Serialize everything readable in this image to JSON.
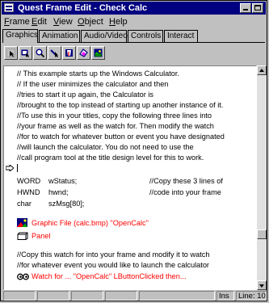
{
  "window": {
    "title": "Quest Frame Edit - Check Calc"
  },
  "menu": [
    {
      "label": "Frame",
      "u": "F",
      "rest": "rame"
    },
    {
      "label": "Edit",
      "u": "E",
      "rest": "dit"
    },
    {
      "label": "View",
      "u": "V",
      "rest": "iew"
    },
    {
      "label": "Object",
      "u": "O",
      "rest": "bject"
    },
    {
      "label": "Help",
      "u": "H",
      "rest": "elp"
    }
  ],
  "tabs": [
    "Graphics",
    "Animation",
    "Audio/Video",
    "Controls",
    "Interact"
  ],
  "active_tab": "Graphics",
  "toolbar_icons": [
    "pointer-tool-icon",
    "frame-tool-icon",
    "zoom-tool-icon",
    "line-tool-icon",
    "bucket-tool-icon",
    "paint-tool-icon",
    "picture-tool-icon"
  ],
  "editor": {
    "comments1": [
      "// This example starts up the Windows Calculator.",
      "// If the user minimizes the calculator and then",
      "//tries to start it up again, the Calculator is",
      "//brought to the top instead of starting up another instance of it.",
      "//To use this in your titles, copy the following three lines into",
      "//your frame as well as the watch for.  Then modify the watch",
      "//for to watch for whatever button or event you have designated",
      "//will launch the calculator.  You do not need to use the",
      "//call program tool at the title design level for this to work."
    ],
    "declarations": [
      {
        "type": "WORD",
        "name": "wStatus;",
        "comment": "//Copy these 3 lines of"
      },
      {
        "type": "HWND",
        "name": "hwnd;",
        "comment": "//code into your frame"
      },
      {
        "type": "char",
        "name": "szMsg[80];",
        "comment": ""
      }
    ],
    "object_graphic": "Graphic File (calc.bmp) \"OpenCalc\"",
    "object_panel": "Panel",
    "comments2": [
      "//Copy this watch for into your frame and modify it to watch",
      "//for whatever event you would like to launch the calculator"
    ],
    "watch_line": "Watch for ... \"OpenCalc\" LButtonClicked then...",
    "scroll_position": 0.79
  },
  "status": {
    "mode": "Ins",
    "line": "Line: 10"
  },
  "colors": {
    "titlebar": "#000080",
    "object_text": "#ff0000"
  }
}
